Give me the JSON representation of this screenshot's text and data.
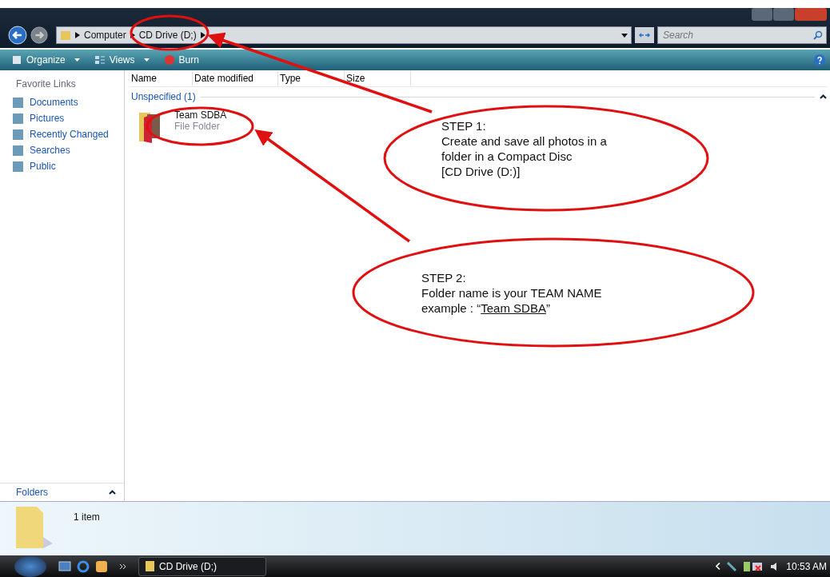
{
  "address_bar": {
    "crumbs": [
      "Computer",
      "CD Drive (D;)"
    ]
  },
  "search": {
    "placeholder": "Search"
  },
  "toolbar": [
    "Organize",
    "Views",
    "Burn"
  ],
  "sidebar": {
    "heading": "Favorite Links",
    "items": [
      "Documents",
      "Pictures",
      "Recently Changed",
      "Searches",
      "Public"
    ],
    "folders_label": "Folders"
  },
  "columns": [
    "Name",
    "Date modified",
    "Type",
    "Size"
  ],
  "group": "Unspecified (1)",
  "files": [
    {
      "name": "Team SDBA",
      "type": "File Folder"
    }
  ],
  "details": {
    "count": "1 item"
  },
  "taskbar": {
    "window": "CD Drive (D;)",
    "time": "10:53 AM"
  },
  "callouts": [
    {
      "lines": [
        "STEP 1:",
        "Create and save all photos in a",
        "folder in a Compact Disc",
        "[CD Drive (D:)]"
      ]
    },
    {
      "lines": [
        "STEP 2:",
        "Folder name is your TEAM NAME"
      ],
      "example": {
        "prefix": "example : “",
        "underlined": "Team SDBA",
        "suffix": "”"
      }
    }
  ]
}
